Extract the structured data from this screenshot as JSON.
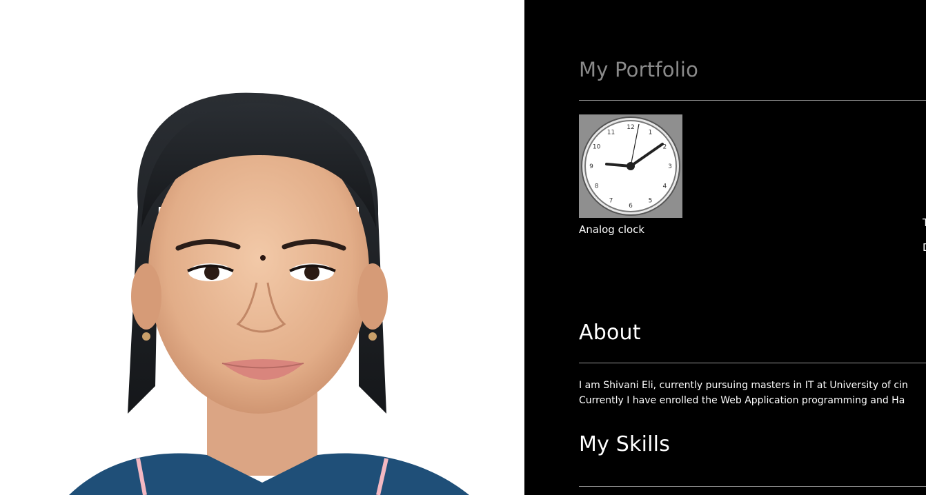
{
  "profile": {
    "photo_alt": "Portrait photo"
  },
  "portfolio": {
    "title": "My Portfolio",
    "projects": [
      {
        "label": "Analog clock",
        "thumbnail_icon": "analog-clock-icon",
        "clock_numbers": [
          "12",
          "1",
          "2",
          "3",
          "4",
          "5",
          "6",
          "7",
          "8",
          "9",
          "10",
          "11"
        ]
      }
    ],
    "cut_off_text": [
      "T",
      "D"
    ]
  },
  "about": {
    "title": "About",
    "lines": [
      "I am Shivani Eli, currently pursuing masters in IT at University of cin",
      "Currently I have enrolled the Web Application programming and Ha"
    ]
  },
  "skills": {
    "title": "My Skills"
  },
  "colors": {
    "background": "#000000",
    "portfolio_title": "#8a8a8a",
    "text": "#ffffff",
    "rule": "#9a9a9a",
    "thumbnail_bg": "#8f8f8f"
  }
}
